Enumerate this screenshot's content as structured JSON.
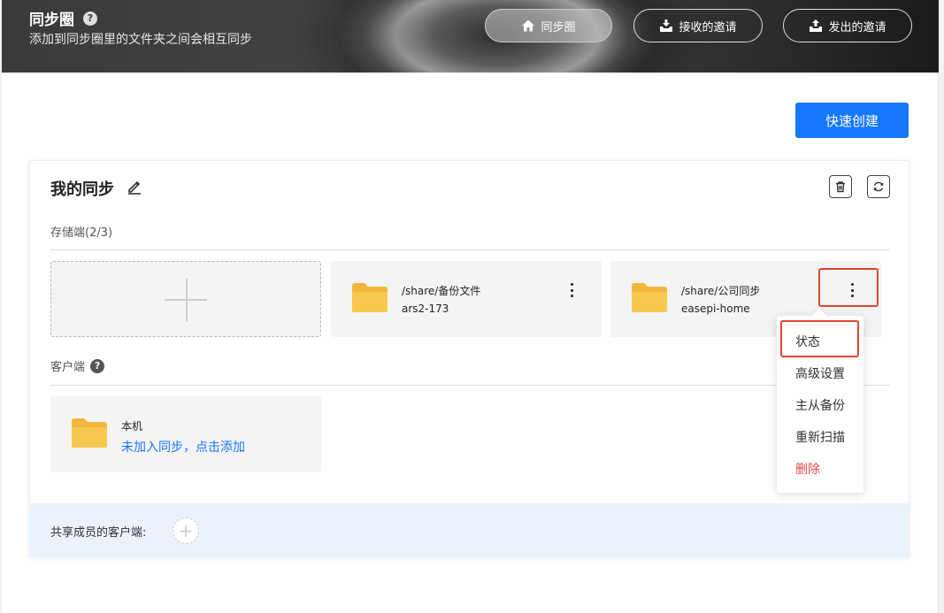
{
  "header": {
    "title": "同步圈",
    "help": "?",
    "subtitle": "添加到同步圈里的文件夹之间会相互同步",
    "nav": [
      {
        "label": "同步圈",
        "icon": "home-icon",
        "active": true
      },
      {
        "label": "接收的邀请",
        "icon": "inbox-download-icon",
        "active": false
      },
      {
        "label": "发出的邀请",
        "icon": "inbox-upload-icon",
        "active": false
      }
    ]
  },
  "actions": {
    "quick_create": "快速创建"
  },
  "card": {
    "title": "我的同步",
    "storage_label": "存储端(2/3)",
    "storage_tiles": [
      {
        "path": "/share/备份文件",
        "device": "ars2-173"
      },
      {
        "path": "/share/公司同步",
        "device": "easepi-home"
      }
    ],
    "client_label": "客户端",
    "client_help": "?",
    "client_tile": {
      "name": "本机",
      "link": "未加入同步，点击添加"
    },
    "share_label": "共享成员的客户端:",
    "share_add": "+"
  },
  "menu": {
    "items": [
      {
        "label": "状态",
        "danger": false
      },
      {
        "label": "高级设置",
        "danger": false
      },
      {
        "label": "主从备份",
        "danger": false
      },
      {
        "label": "重新扫描",
        "danger": false
      },
      {
        "label": "删除",
        "danger": true
      }
    ]
  },
  "colors": {
    "primary": "#1677ff",
    "danger": "#e5484d",
    "highlight": "#e0452f",
    "folder": "#f9c84e"
  }
}
